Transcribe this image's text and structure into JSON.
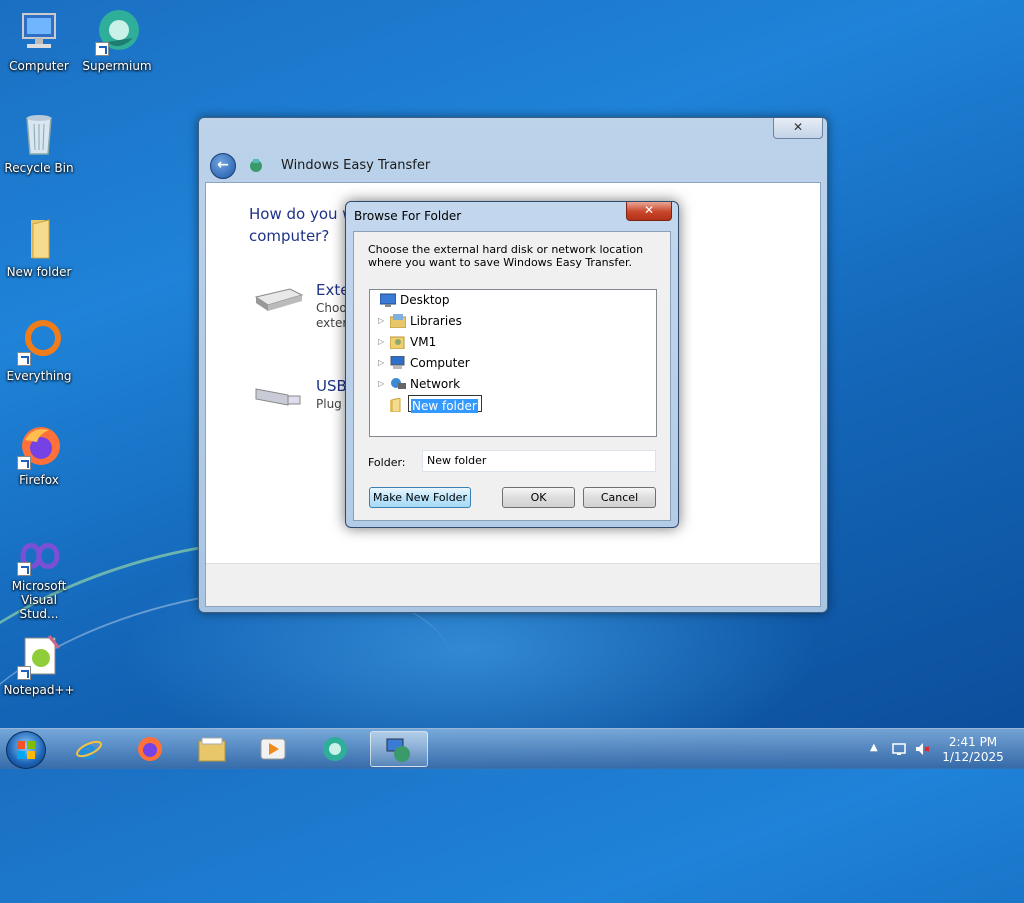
{
  "desktop": {
    "icons": [
      {
        "label": "Computer"
      },
      {
        "label": "Supermium"
      },
      {
        "label": "Recycle Bin"
      },
      {
        "label": "New folder"
      },
      {
        "label": "Everything"
      },
      {
        "label": "Firefox"
      },
      {
        "label": "Microsoft Visual Stud..."
      },
      {
        "label": "Notepad++"
      }
    ]
  },
  "main_window": {
    "title": "Windows Easy Transfer",
    "close_label": "✕",
    "question": "How do you w… computer?",
    "question_line1": "How do you w",
    "question_line2": "computer?",
    "options": [
      {
        "title": "Exter",
        "desc1": "Choos",
        "desc2": "exter"
      },
      {
        "title": "USB",
        "desc1": "Plug i"
      }
    ]
  },
  "dialog": {
    "title": "Browse For Folder",
    "close_label": "✕",
    "description": "Choose the external hard disk or network location where you want to save Windows Easy Transfer.",
    "tree": [
      {
        "label": "Desktop",
        "icon": "desktop-icon"
      },
      {
        "label": "Libraries",
        "icon": "libraries-icon"
      },
      {
        "label": "VM1",
        "icon": "user-folder-icon"
      },
      {
        "label": "Computer",
        "icon": "computer-icon"
      },
      {
        "label": "Network",
        "icon": "network-icon"
      }
    ],
    "new_folder_edit": "New folder",
    "folder_label": "Folder:",
    "folder_value": "New folder",
    "buttons": {
      "make_new_folder": "Make New Folder",
      "ok": "OK",
      "cancel": "Cancel"
    }
  },
  "taskbar": {
    "apps": [
      "Internet Explorer",
      "Firefox",
      "Windows Explorer",
      "Media Player",
      "Supermium",
      "Windows Easy Transfer"
    ],
    "clock_time": "2:41 PM",
    "clock_date": "1/12/2025"
  },
  "colors": {
    "accent": "#1e3287",
    "selection": "#3399ff"
  }
}
